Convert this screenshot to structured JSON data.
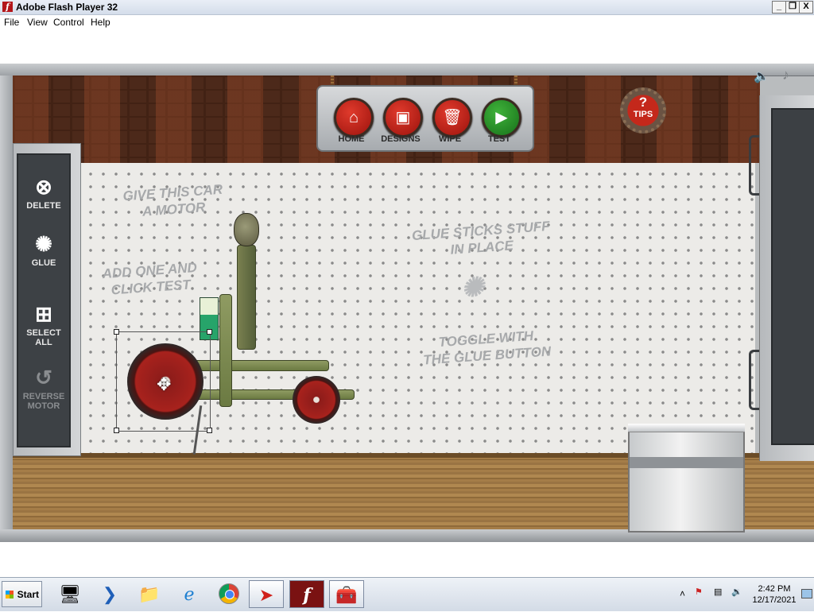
{
  "window": {
    "title": "Adobe Flash Player 32",
    "controls": [
      "_",
      "❐",
      "X"
    ]
  },
  "menu": [
    "File",
    "View",
    "Control",
    "Help"
  ],
  "top_menu": {
    "home": "HOME",
    "designs": "DESIGNS",
    "wipe": "WIPE",
    "test": "TEST"
  },
  "tips": {
    "symbol": "?",
    "label": "TIPS"
  },
  "tools": {
    "delete": "DELETE",
    "glue": "GLUE",
    "select_all_1": "SELECT",
    "select_all_2": "ALL",
    "reverse_1": "REVERSE",
    "reverse_2": "MOTOR"
  },
  "hints": {
    "h1a": "GIVE THIS CAR",
    "h1b": "A MOTOR",
    "h2a": "ADD ONE AND",
    "h2b": "CLICK TEST",
    "h3a": "GLUE STICKS STUFF",
    "h3b": "IN PLACE",
    "h4a": "TOGGLE WITH",
    "h4b": "THE GLUE BUTTON"
  },
  "taskbar": {
    "start": "Start",
    "time": "2:42 PM",
    "date": "12/17/2021"
  },
  "colors": {
    "accent_red": "#c4281b",
    "test_green": "#2e9a2a"
  }
}
